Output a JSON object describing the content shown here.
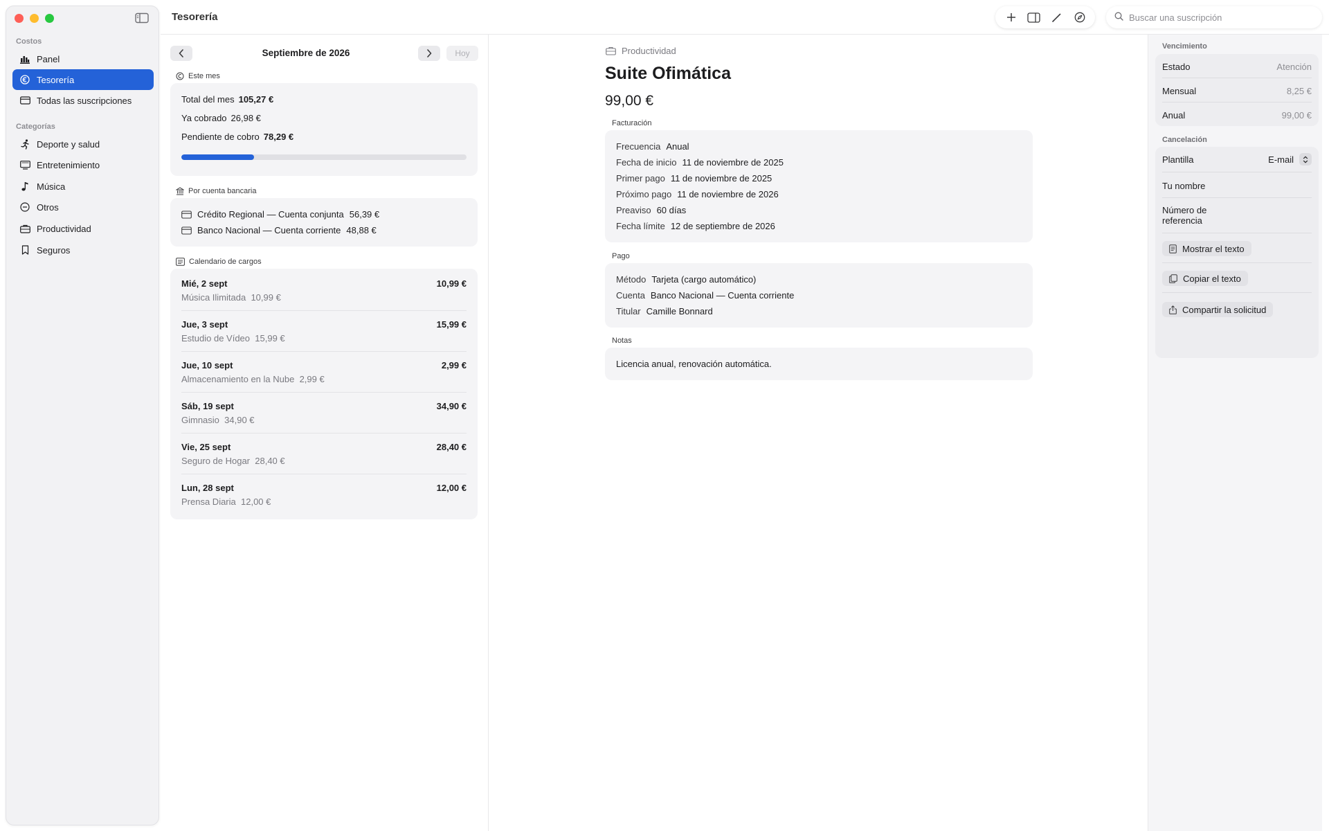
{
  "window": {
    "title": "Tesorería"
  },
  "search": {
    "placeholder": "Buscar una suscripción"
  },
  "sidebar": {
    "section_costs": "Costos",
    "costs_items": [
      {
        "label": "Panel",
        "icon": "chart-bar-icon"
      },
      {
        "label": "Tesorería",
        "icon": "euro-circle-icon",
        "active": true
      },
      {
        "label": "Todas las suscripciones",
        "icon": "card-icon"
      }
    ],
    "section_categories": "Categorías",
    "category_items": [
      {
        "label": "Deporte y salud",
        "icon": "running-icon"
      },
      {
        "label": "Entretenimiento",
        "icon": "tv-icon"
      },
      {
        "label": "Música",
        "icon": "music-note-icon"
      },
      {
        "label": "Otros",
        "icon": "minus-circle-icon"
      },
      {
        "label": "Productividad",
        "icon": "briefcase-icon"
      },
      {
        "label": "Seguros",
        "icon": "bookmark-icon"
      }
    ]
  },
  "treasury": {
    "month": "Septiembre de 2026",
    "today_label": "Hoy",
    "this_month": {
      "label": "Este mes",
      "total_label": "Total del mes",
      "total_value": "105,27 €",
      "collected_label": "Ya cobrado",
      "collected_value": "26,98 €",
      "pending_label": "Pendiente de cobro",
      "pending_value": "78,29 €",
      "progress": 0.256
    },
    "by_account": {
      "label": "Por cuenta bancaria",
      "accounts": [
        {
          "name": "Crédito Regional — Cuenta conjunta",
          "amount": "56,39 €"
        },
        {
          "name": "Banco Nacional — Cuenta corriente",
          "amount": "48,88 €"
        }
      ]
    },
    "calendar": {
      "label": "Calendario de cargos",
      "rows": [
        {
          "date": "Mié, 2 sept",
          "amount": "10,99 €",
          "name": "Música Ilimitada",
          "sub_amount": "10,99 €"
        },
        {
          "date": "Jue, 3 sept",
          "amount": "15,99 €",
          "name": "Estudio de Vídeo",
          "sub_amount": "15,99 €"
        },
        {
          "date": "Jue, 10 sept",
          "amount": "2,99 €",
          "name": "Almacenamiento en la Nube",
          "sub_amount": "2,99 €"
        },
        {
          "date": "Sáb, 19 sept",
          "amount": "34,90 €",
          "name": "Gimnasio",
          "sub_amount": "34,90 €"
        },
        {
          "date": "Vie, 25 sept",
          "amount": "28,40 €",
          "name": "Seguro de Hogar",
          "sub_amount": "28,40 €"
        },
        {
          "date": "Lun, 28 sept",
          "amount": "12,00 €",
          "name": "Prensa Diaria",
          "sub_amount": "12,00 €"
        }
      ]
    }
  },
  "detail": {
    "category": "Productividad",
    "title": "Suite Ofimática",
    "price": "99,00 €",
    "billing": {
      "label": "Facturación",
      "rows": [
        {
          "k": "Frecuencia",
          "v": "Anual"
        },
        {
          "k": "Fecha de inicio",
          "v": "11 de noviembre de 2025"
        },
        {
          "k": "Primer pago",
          "v": "11 de noviembre de 2025"
        },
        {
          "k": "Próximo pago",
          "v": "11 de noviembre de 2026"
        },
        {
          "k": "Preaviso",
          "v": "60 días"
        },
        {
          "k": "Fecha límite",
          "v": "12 de septiembre de 2026"
        }
      ]
    },
    "payment": {
      "label": "Pago",
      "rows": [
        {
          "k": "Método",
          "v": "Tarjeta (cargo automático)"
        },
        {
          "k": "Cuenta",
          "v": "Banco Nacional — Cuenta corriente"
        },
        {
          "k": "Titular",
          "v": "Camille Bonnard"
        }
      ]
    },
    "notes": {
      "label": "Notas",
      "text": "Licencia anual, renovación automática."
    }
  },
  "inspector": {
    "expiry": {
      "label": "Vencimiento",
      "rows": [
        {
          "k": "Estado",
          "v": "Atención"
        },
        {
          "k": "Mensual",
          "v": "8,25 €"
        },
        {
          "k": "Anual",
          "v": "99,00 €"
        }
      ]
    },
    "cancellation": {
      "label": "Cancelación",
      "template_label": "Plantilla",
      "template_value": "E-mail",
      "name_label": "Tu nombre",
      "ref_label_1": "Número de",
      "ref_label_2": "referencia",
      "show_text": "Mostrar el texto",
      "copy_text": "Copiar el texto",
      "share": "Compartir la solicitud"
    }
  },
  "colors": {
    "accent": "#2462d8"
  }
}
